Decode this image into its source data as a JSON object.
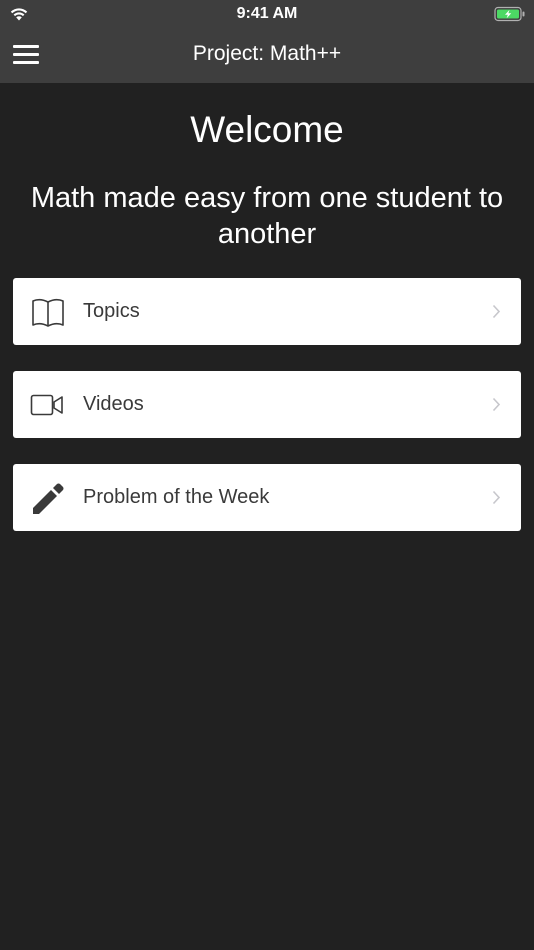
{
  "status_bar": {
    "time": "9:41 AM",
    "wifi_icon": "wifi-icon",
    "battery_icon": "battery-charging-icon",
    "battery_color": "#4cd964"
  },
  "nav": {
    "title": "Project: Math++",
    "menu_icon": "hamburger-menu-icon"
  },
  "main": {
    "heading": "Welcome",
    "tagline": "Math made easy from one student to another"
  },
  "menu": {
    "items": [
      {
        "label": "Topics",
        "icon": "book-icon"
      },
      {
        "label": "Videos",
        "icon": "video-camera-icon"
      },
      {
        "label": "Problem of the Week",
        "icon": "pencil-icon"
      }
    ]
  },
  "colors": {
    "background": "#212121",
    "bar": "#3e3e3e",
    "card": "#ffffff",
    "card_text": "#3a3a3a"
  }
}
